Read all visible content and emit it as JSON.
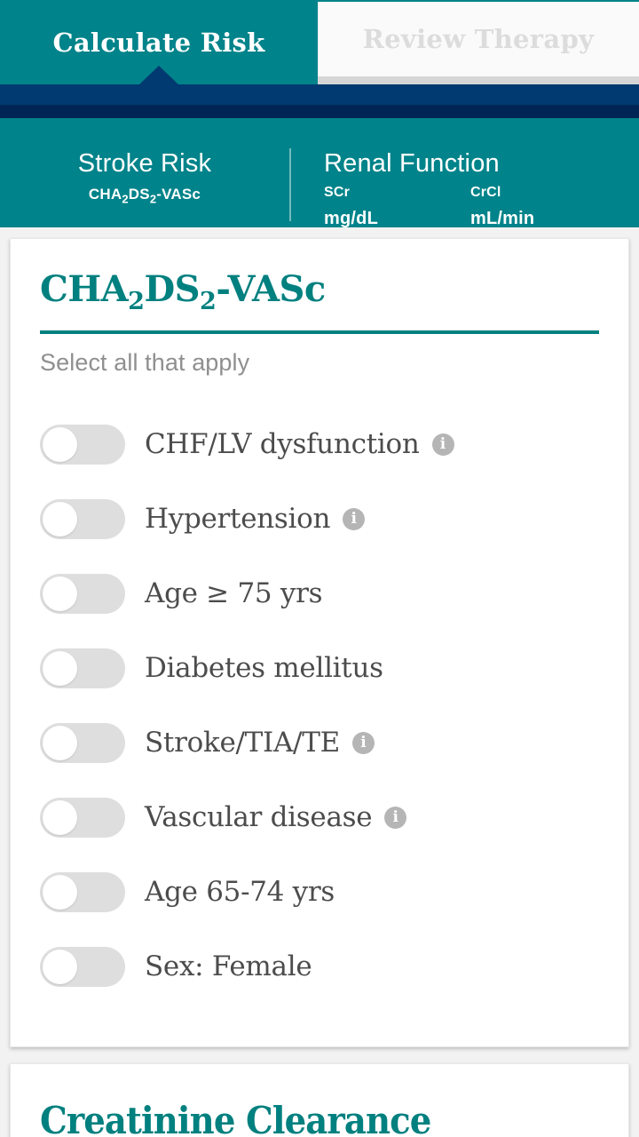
{
  "tabs": [
    {
      "label": "Calculate Risk",
      "active": true
    },
    {
      "label": "Review Therapy",
      "active": false
    }
  ],
  "subheader": {
    "stroke": {
      "title": "Stroke Risk",
      "score_prefix": "CHA",
      "score_sub1": "2",
      "score_mid": "DS",
      "score_sub2": "2",
      "score_suffix": "-VASc"
    },
    "renal": {
      "title": "Renal Function",
      "fields": [
        {
          "label": "SCr",
          "unit": "mg/dL"
        },
        {
          "label": "CrCl",
          "unit": "mL/min"
        }
      ]
    }
  },
  "chads_card": {
    "title_prefix": "CHA",
    "title_sub1": "2",
    "title_mid": "DS",
    "title_sub2": "2",
    "title_suffix": "-VASc",
    "subtitle": "Select all that apply",
    "rows": [
      {
        "label": "CHF/LV dysfunction",
        "info": true,
        "on": false
      },
      {
        "label": "Hypertension",
        "info": true,
        "on": false
      },
      {
        "label": "Age ≥ 75 yrs",
        "info": false,
        "on": false
      },
      {
        "label": "Diabetes mellitus",
        "info": false,
        "on": false
      },
      {
        "label": "Stroke/TIA/TE",
        "info": true,
        "on": false
      },
      {
        "label": "Vascular disease",
        "info": true,
        "on": false
      },
      {
        "label": "Age 65-74 yrs",
        "info": false,
        "on": false
      },
      {
        "label": "Sex: Female",
        "info": false,
        "on": false
      }
    ]
  },
  "crcl_card": {
    "title": "Creatinine Clearance"
  },
  "colors": {
    "teal": "#00838a",
    "teal_text": "#00807f",
    "navy": "#003a70",
    "navy_dark": "#002554",
    "page_bg": "#f2f2f2",
    "toggle_off": "#dedede",
    "label_text": "#4c4c4c",
    "muted_text": "#8f8f8f",
    "info_grey": "#b5b5b5"
  },
  "icons": {
    "info": "info-icon",
    "tab_pointer": "caret-up-icon"
  }
}
